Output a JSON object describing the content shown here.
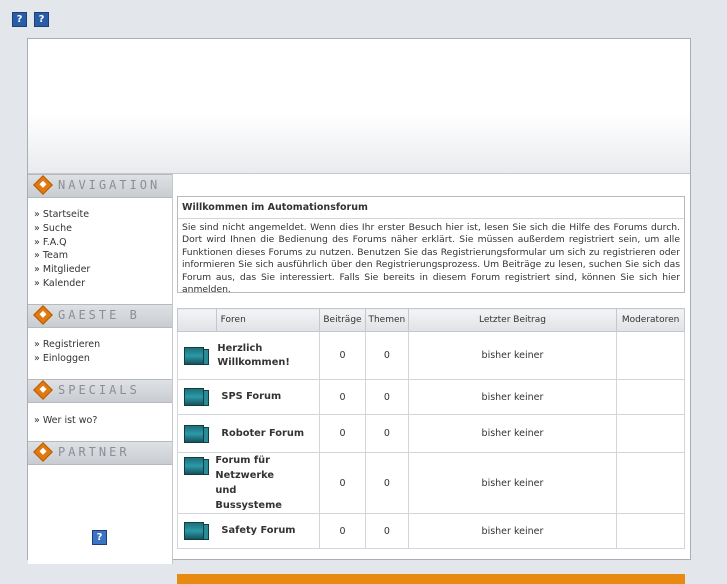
{
  "top_icons": [
    {
      "glyph": "?"
    },
    {
      "glyph": "?"
    }
  ],
  "sidebar": {
    "sections": [
      {
        "title": "NAVIGATION",
        "items": [
          "Startseite",
          "Suche",
          "F.A.Q",
          "Team",
          "Mitglieder",
          "Kalender"
        ]
      },
      {
        "title": "GAESTE B",
        "items": [
          "Registrieren",
          "Einloggen"
        ]
      },
      {
        "title": "SPECIALS",
        "items": [
          "Wer ist wo?"
        ]
      },
      {
        "title": "PARTNER",
        "items": []
      }
    ],
    "partner_icon_glyph": "?"
  },
  "welcome": {
    "title": "Willkommen im Automationsforum",
    "text": "Sie sind nicht angemeldet. Wenn dies Ihr erster Besuch hier ist, lesen Sie sich die Hilfe des Forums durch. Dort wird Ihnen die Bedienung des Forums näher erklärt. Sie müssen außerdem registriert sein, um alle Funktionen dieses Forums zu nutzen. Benutzen Sie das Registrierungsformular um sich zu registrieren oder informieren Sie sich ausführlich über den Registrierungsprozess. Um Beiträge zu lesen, suchen Sie sich das Forum aus, das Sie interessiert. Falls Sie bereits in diesem Forum registriert sind, können Sie sich hier anmelden."
  },
  "forum_table": {
    "headers": {
      "forum": "Foren",
      "posts": "Beiträge",
      "topics": "Themen",
      "last_post": "Letzter Beitrag",
      "moderators": "Moderatoren"
    },
    "rows": [
      {
        "name": "Herzlich Willkommen!",
        "posts": "0",
        "topics": "0",
        "last_post": "bisher keiner",
        "moderators": ""
      },
      {
        "name": "SPS Forum",
        "posts": "0",
        "topics": "0",
        "last_post": "bisher keiner",
        "moderators": ""
      },
      {
        "name": "Roboter Forum",
        "posts": "0",
        "topics": "0",
        "last_post": "bisher keiner",
        "moderators": ""
      },
      {
        "name": "Forum für Netzwerke und Bussysteme",
        "posts": "0",
        "topics": "0",
        "last_post": "bisher keiner",
        "moderators": ""
      },
      {
        "name": "Safety Forum",
        "posts": "0",
        "topics": "0",
        "last_post": "bisher keiner",
        "moderators": ""
      }
    ]
  },
  "colors": {
    "accent": "#e88a12",
    "forum_icon": "#2a9aa8",
    "help_icon": "#2a5da8"
  }
}
